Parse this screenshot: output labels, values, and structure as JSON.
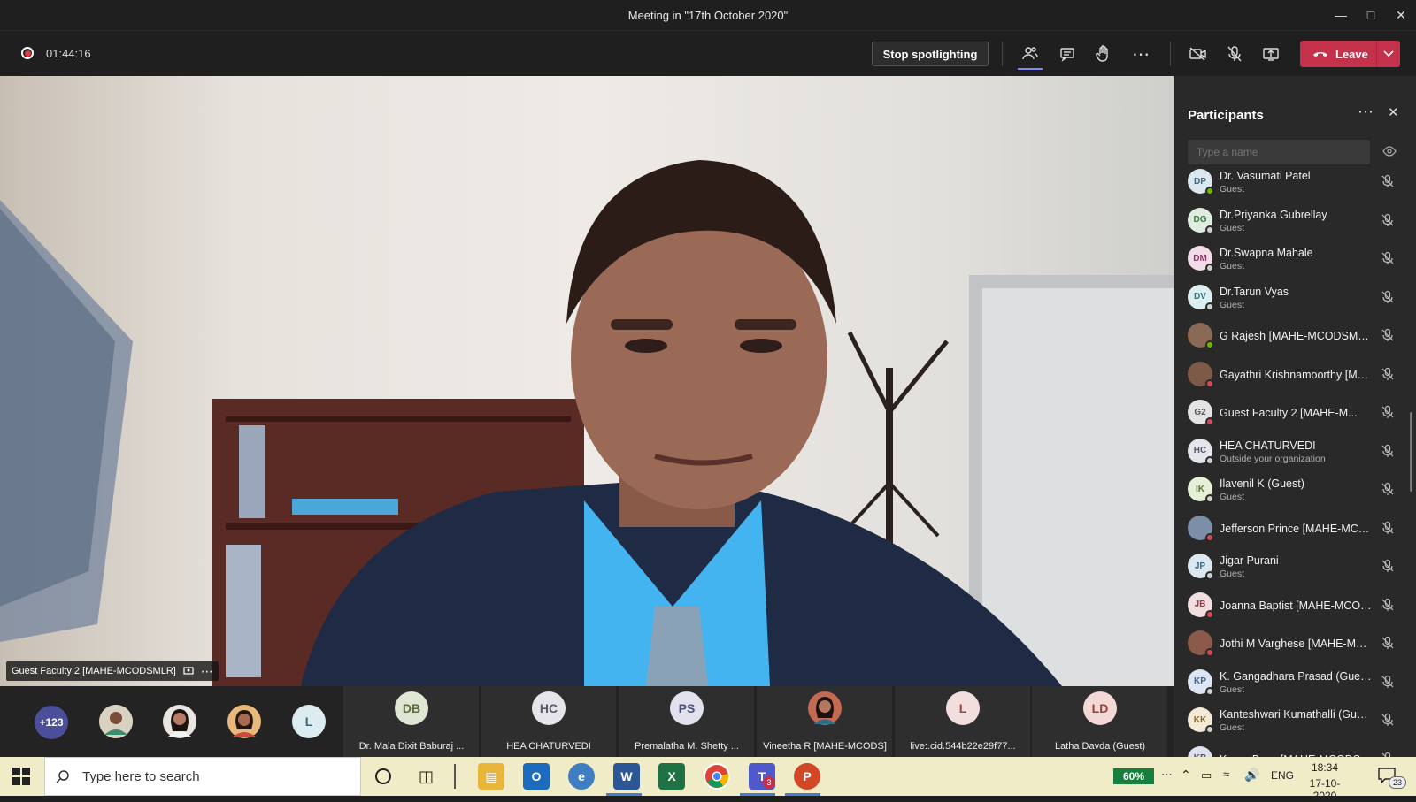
{
  "window": {
    "title": "Meeting in \"17th October 2020\""
  },
  "toolbar": {
    "timer": "01:44:16",
    "stop_spotlight_label": "Stop spotlighting",
    "leave_label": "Leave"
  },
  "video": {
    "label": "Guest Faculty 2 [MAHE-MCODSMLR]"
  },
  "strip": {
    "overflow_count": "+123",
    "thumb_l": "L",
    "tiles": [
      {
        "initials": "DB",
        "name": "Dr. Mala Dixit Baburaj ...",
        "color": "#dfe6d4",
        "text": "#5a6b3c"
      },
      {
        "initials": "HC",
        "name": "HEA CHATURVEDI",
        "color": "#e6e6ea",
        "text": "#55586a"
      },
      {
        "initials": "PS",
        "name": "Premalatha M. Shetty ...",
        "color": "#e2e2ef",
        "text": "#4c4f7a"
      },
      {
        "initials": "",
        "name": "Vineetha R [MAHE-MCODS]",
        "color": "#b9684f",
        "text": "#fff"
      },
      {
        "initials": "L",
        "name": "live:.cid.544b22e29f77...",
        "color": "#f3dede",
        "text": "#9a4646"
      },
      {
        "initials": "LD",
        "name": "Latha Davda (Guest)",
        "color": "#f2d9d6",
        "text": "#9b3e33"
      }
    ]
  },
  "participants": {
    "title": "Participants",
    "search_placeholder": "Type a name",
    "list": [
      {
        "initials": "DP",
        "name": "Dr. Vasumati Patel",
        "sub": "Guest",
        "color": "#dbe8f0",
        "text": "#3d6680",
        "status": "#6bb700"
      },
      {
        "initials": "DG",
        "name": "Dr.Priyanka Gubrellay",
        "sub": "Guest",
        "color": "#dfece0",
        "text": "#3f7a48",
        "status": "#cfcfcf"
      },
      {
        "initials": "DM",
        "name": "Dr.Swapna Mahale",
        "sub": "Guest",
        "color": "#f1dde8",
        "text": "#8c3a68",
        "status": "#cfcfcf"
      },
      {
        "initials": "DV",
        "name": "Dr.Tarun Vyas",
        "sub": "Guest",
        "color": "#dbeef0",
        "text": "#33757c",
        "status": "#cfcfcf"
      },
      {
        "initials": "",
        "name": "G Rajesh [MAHE-MCODSMLR]",
        "sub": "",
        "color": "#8a6a55",
        "text": "#fff",
        "status": "#6bb700"
      },
      {
        "initials": "",
        "name": "Gayathri Krishnamoorthy [MA...",
        "sub": "",
        "color": "#7d5a48",
        "text": "#fff",
        "status": "#d74654"
      },
      {
        "initials": "G2",
        "name": "Guest Faculty 2 [MAHE-M...",
        "sub": "",
        "color": "#e4e4e4",
        "text": "#555",
        "status": "#d74654"
      },
      {
        "initials": "HC",
        "name": "HEA CHATURVEDI",
        "sub": "Outside your organization",
        "color": "#e4e6ec",
        "text": "#55586a",
        "status": "#cfcfcf"
      },
      {
        "initials": "IK",
        "name": "Ilavenil K (Guest)",
        "sub": "Guest",
        "color": "#e6efd8",
        "text": "#587232",
        "status": "#cfcfcf"
      },
      {
        "initials": "",
        "name": "Jefferson Prince [MAHE-MCO...",
        "sub": "",
        "color": "#7b8fa8",
        "text": "#fff",
        "status": "#d74654"
      },
      {
        "initials": "JP",
        "name": "Jigar Purani",
        "sub": "Guest",
        "color": "#dbe8f0",
        "text": "#3d6680",
        "status": "#cfcfcf"
      },
      {
        "initials": "JB",
        "name": "Joanna Baptist [MAHE-MCODS]",
        "sub": "",
        "color": "#f2dde0",
        "text": "#8f3c48",
        "status": "#d74654"
      },
      {
        "initials": "",
        "name": "Jothi M Varghese [MAHE-MC...",
        "sub": "",
        "color": "#8b5a4a",
        "text": "#fff",
        "status": "#d74654"
      },
      {
        "initials": "KP",
        "name": "K. Gangadhara Prasad (Guest)",
        "sub": "Guest",
        "color": "#dde6f2",
        "text": "#3f5f8c",
        "status": "#cfcfcf"
      },
      {
        "initials": "KK",
        "name": "Kanteshwari Kumathalli (Guest)",
        "sub": "Guest",
        "color": "#f3ead8",
        "text": "#8c6a2a",
        "status": "#cfcfcf"
      },
      {
        "initials": "KB",
        "name": "Karen Boaz [MAHE-MCODSM...",
        "sub": "",
        "color": "#dde0ee",
        "text": "#4b5080",
        "status": "#d74654"
      }
    ]
  },
  "taskbar": {
    "search_placeholder": "Type here to search",
    "battery": "60%",
    "lang": "ENG",
    "time": "18:34",
    "date": "17-10-2020",
    "notif_count": "23",
    "teams_badge": "3"
  }
}
